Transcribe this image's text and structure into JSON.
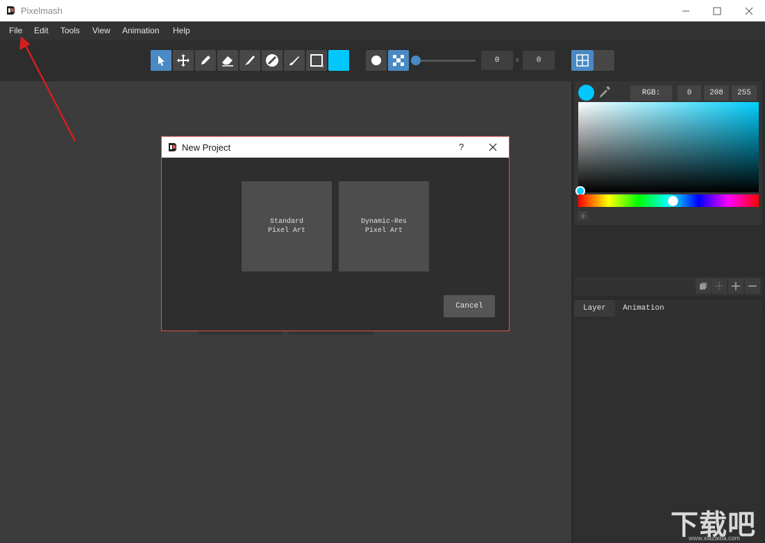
{
  "window": {
    "title": "Pixelmash"
  },
  "menu": [
    "File",
    "Edit",
    "Tools",
    "View",
    "Animation",
    "Help"
  ],
  "toolbar": {
    "tools": [
      "select-arrow-icon",
      "move-icon",
      "pencil-icon",
      "eraser-icon",
      "brush-icon",
      "fill-icon",
      "smudge-icon",
      "rectangle-icon"
    ],
    "current_color": "#00c8ff",
    "size_x": "0",
    "size_y": "0",
    "separator": "x"
  },
  "color_panel": {
    "mode_label": "RGB:",
    "r": "0",
    "g": "208",
    "b": "255",
    "swatch": "#00d0ff"
  },
  "layers": {
    "tabs": [
      "Layer",
      "Animation"
    ]
  },
  "dialog": {
    "title": "New Project",
    "help": "?",
    "cards": [
      "Standard\nPixel Art",
      "Dynamic-Res\nPixel Art"
    ],
    "cancel_label": "Cancel"
  },
  "watermark": {
    "text": "下载吧",
    "url": "www.xiazaiba.com"
  }
}
